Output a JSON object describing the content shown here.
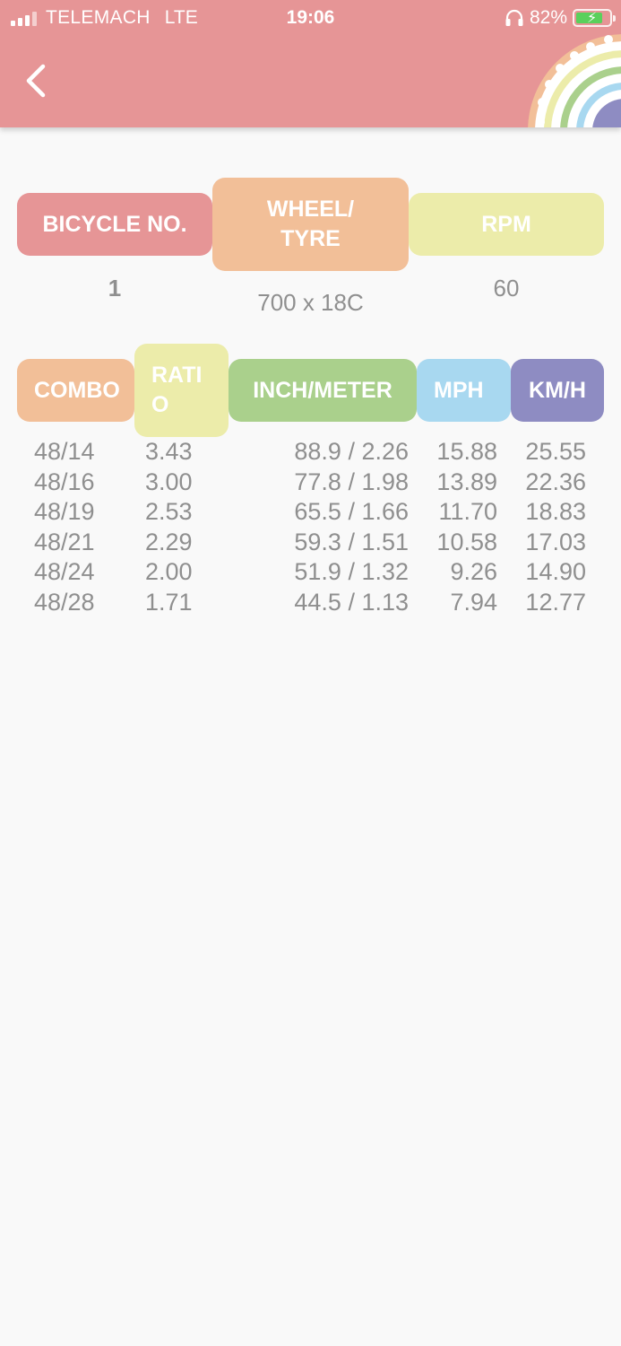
{
  "status_bar": {
    "carrier": "TELEMACH",
    "network": "LTE",
    "time": "19:06",
    "battery_percent": "82%",
    "battery_level": 0.82,
    "icons": [
      "signal-icon",
      "headphones-icon",
      "battery-charging-icon"
    ]
  },
  "header": {
    "back_icon": "chevron-left-icon",
    "logo_icon": "rainbow-gear-icon",
    "color": "#e69596"
  },
  "summary": {
    "headers": {
      "bicycle_no": "BICYCLE NO.",
      "wheel_tyre": "WHEEL/\nTYRE",
      "rpm": "RPM"
    },
    "values": {
      "bicycle_no": "1",
      "wheel_tyre": "700 x 18C",
      "rpm": "60"
    }
  },
  "table": {
    "headers": {
      "combo": "COMBO",
      "ratio": "RATI\nO",
      "inch_meter": "INCH/METER",
      "mph": "MPH",
      "kmh": "KM/H"
    },
    "rows": [
      {
        "combo": "48/14",
        "ratio": "3.43",
        "inch_meter": "88.9 / 2.26",
        "mph": "15.88",
        "kmh": "25.55"
      },
      {
        "combo": "48/16",
        "ratio": "3.00",
        "inch_meter": "77.8 / 1.98",
        "mph": "13.89",
        "kmh": "22.36"
      },
      {
        "combo": "48/19",
        "ratio": "2.53",
        "inch_meter": "65.5 / 1.66",
        "mph": "11.70",
        "kmh": "18.83"
      },
      {
        "combo": "48/21",
        "ratio": "2.29",
        "inch_meter": "59.3 / 1.51",
        "mph": "10.58",
        "kmh": "17.03"
      },
      {
        "combo": "48/24",
        "ratio": "2.00",
        "inch_meter": "51.9 / 1.32",
        "mph": "9.26",
        "kmh": "14.90"
      },
      {
        "combo": "48/28",
        "ratio": "1.71",
        "inch_meter": "44.5 / 1.13",
        "mph": "7.94",
        "kmh": "12.77"
      }
    ]
  },
  "colors": {
    "pink": "#e69596",
    "orange": "#f2bf98",
    "yellow": "#ececaa",
    "green": "#aad08c",
    "blue": "#a8d8f0",
    "purple": "#8e8cc2",
    "text": "#8f8f8f",
    "background": "#f9f9f9"
  }
}
